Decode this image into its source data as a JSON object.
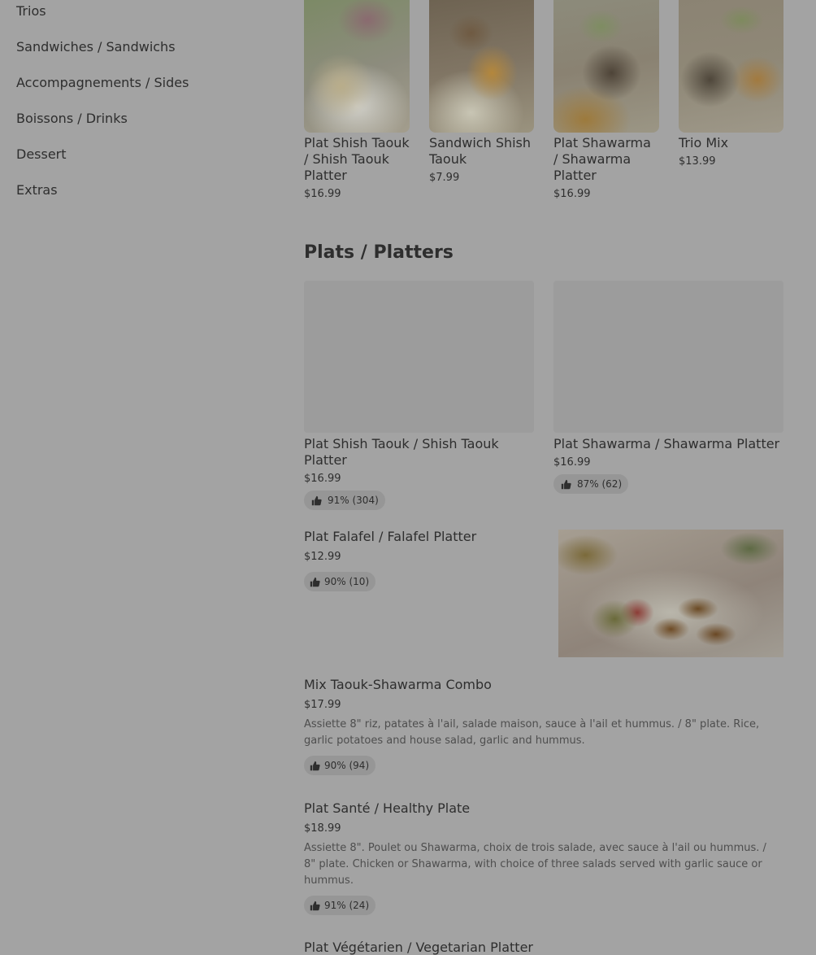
{
  "sidebar": {
    "categories": [
      "Trios",
      "Sandwiches / Sandwichs",
      "Accompagnements / Sides",
      "Boissons / Drinks",
      "Dessert",
      "Extras"
    ]
  },
  "carousel": {
    "items": [
      {
        "title": "Plat Shish Taouk / Shish Taouk Platter",
        "price": "$16.99",
        "image": "shish-taouk-platter-photo"
      },
      {
        "title": "Sandwich Shish Taouk",
        "price": "$7.99",
        "image": "sandwich-shish-taouk-photo"
      },
      {
        "title": "Plat Shawarma / Shawarma Platter",
        "price": "$16.99",
        "image": "shawarma-platter-photo"
      },
      {
        "title": "Trio Mix",
        "price": "$13.99",
        "image": "trio-mix-photo"
      }
    ]
  },
  "section": {
    "title": "Plats / Platters"
  },
  "platters": [
    {
      "title": "Plat Shish Taouk / Shish Taouk Platter",
      "price": "$16.99",
      "rating": "91% (304)"
    },
    {
      "title": "Plat Shawarma / Shawarma Platter",
      "price": "$16.99",
      "rating": "87% (62)"
    }
  ],
  "list": [
    {
      "title": "Plat Falafel / Falafel Platter",
      "price": "$12.99",
      "rating": "90% (10)",
      "image": "falafel-platter-photo"
    },
    {
      "title": "Mix Taouk-Shawarma Combo",
      "price": "$17.99",
      "description": "Assiette 8\" riz, patates à l'ail, salade maison, sauce à l'ail et hummus. / 8\" plate. Rice, garlic potatoes and house salad, garlic and hummus.",
      "rating": "90% (94)"
    },
    {
      "title": "Plat Santé / Healthy Plate",
      "price": "$18.99",
      "description": "Assiette 8\". Poulet ou Shawarma, choix de trois salade, avec sauce à l'ail ou hummus. / 8\" plate. Chicken or Shawarma, with choice of three salads served with garlic sauce or hummus.",
      "rating": "91% (24)"
    },
    {
      "title": "Plat Végétarien / Vegetarian Platter"
    }
  ],
  "icons": {
    "rating": "thumbs-up-icon"
  },
  "colors": {
    "overlay_background": "#a3a3a3",
    "text": "#2e2e2e",
    "badge": "#969696"
  }
}
